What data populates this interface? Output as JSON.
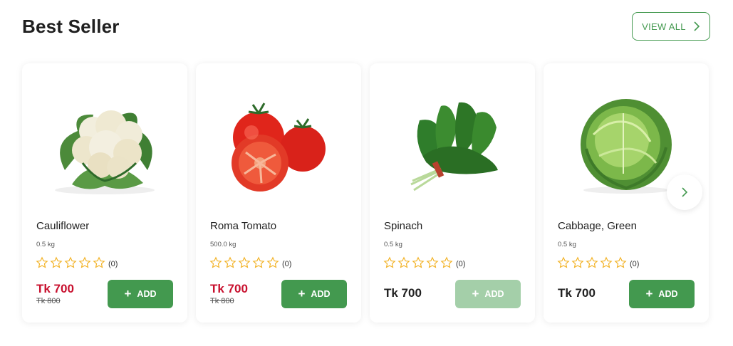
{
  "section": {
    "title": "Best Seller",
    "view_all_label": "VIEW ALL"
  },
  "colors": {
    "brand_green": "#43994f",
    "sale_red": "#c8102e",
    "star_yellow": "#f2b01e",
    "disabled_green": "#a4cfa9"
  },
  "icons": {
    "view_all": "chevron-right-icon",
    "next": "chevron-right-icon",
    "star": "star-outline-icon",
    "add": "plus-icon"
  },
  "products": [
    {
      "name": "Cauliflower",
      "weight": "0.5 kg",
      "rating_count": "(0)",
      "stars_filled": 0,
      "price": "Tk 700",
      "old_price": "Tk 800",
      "add_label": "ADD",
      "add_enabled": true
    },
    {
      "name": "Roma Tomato",
      "weight": "500.0 kg",
      "rating_count": "(0)",
      "stars_filled": 0,
      "price": "Tk 700",
      "old_price": "Tk 800",
      "add_label": "ADD",
      "add_enabled": true
    },
    {
      "name": "Spinach",
      "weight": "0.5 kg",
      "rating_count": "(0)",
      "stars_filled": 0,
      "price": "Tk 700",
      "old_price": "",
      "add_label": "ADD",
      "add_enabled": false
    },
    {
      "name": "Cabbage, Green",
      "weight": "0.5 kg",
      "rating_count": "(0)",
      "stars_filled": 0,
      "price": "Tk 700",
      "old_price": "",
      "add_label": "ADD",
      "add_enabled": true
    }
  ]
}
